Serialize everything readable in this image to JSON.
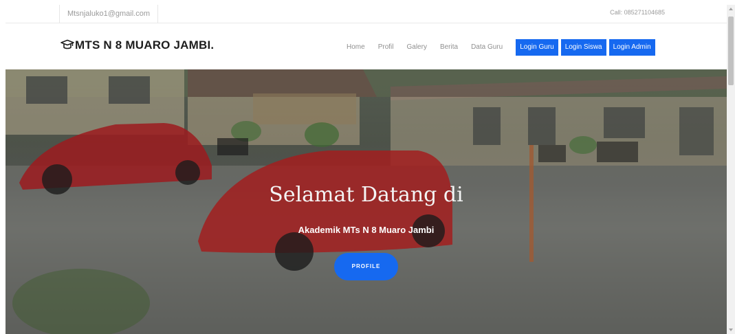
{
  "topbar": {
    "email": "Mtsnjaluko1@gmail.com",
    "call": "Call: 085271104685"
  },
  "navbar": {
    "brand": "MTS N 8 MUARO JAMBI.",
    "brand_icon": "graduation-cap-icon",
    "links": [
      "Home",
      "Profil",
      "Galery",
      "Berita",
      "Data Guru"
    ],
    "buttons": [
      "Login Guru",
      "Login Siswa",
      "Login Admin"
    ],
    "accent_color": "#1669f0"
  },
  "hero": {
    "title": "Selamat Datang di",
    "subtitle": "Akademik MTs N 8 Muaro Jambi",
    "button_label": "PROFILE"
  }
}
